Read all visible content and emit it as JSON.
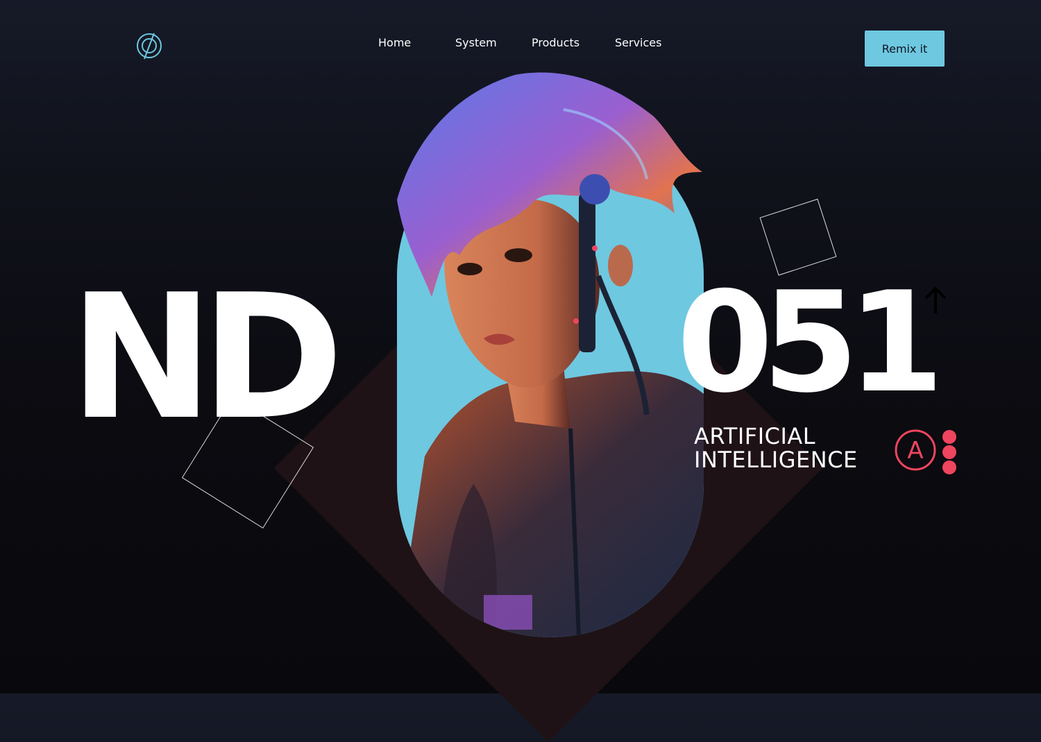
{
  "header": {
    "logo_icon": "target-ring-icon",
    "nav": [
      {
        "label": "Home"
      },
      {
        "label": "System"
      },
      {
        "label": "Products"
      },
      {
        "label": "Services"
      }
    ],
    "cta_label": "Remix it"
  },
  "hero": {
    "title_left": "ND",
    "title_right": "051",
    "subtitle_line1": "ARTIFICIAL",
    "subtitle_line2": "INTELLIGENCE",
    "badge_letter": "A",
    "arrow_icon": "arrow-up-icon",
    "portrait": "cyberpunk-woman-portrait"
  },
  "colors": {
    "accent": "#6ec8e0",
    "pink": "#f0455f",
    "diamond": "#1e1216",
    "background": "#0b0b10"
  }
}
